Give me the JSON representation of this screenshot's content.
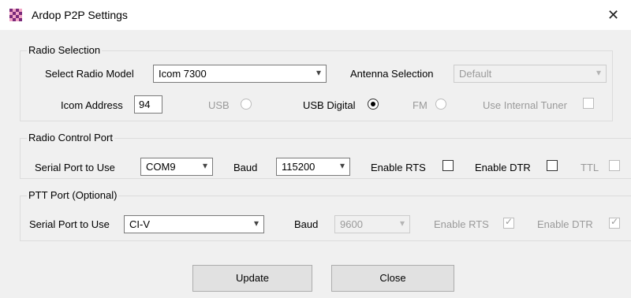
{
  "window": {
    "title": "Ardop P2P Settings",
    "close_glyph": "✕"
  },
  "radio_selection": {
    "legend": "Radio Selection",
    "model_label": "Select Radio Model",
    "model_value": "Icom 7300",
    "antenna_label": "Antenna Selection",
    "antenna_value": "Default",
    "address_label": "Icom Address",
    "address_value": "94",
    "usb_label": "USB",
    "usb_digital_label": "USB Digital",
    "fm_label": "FM",
    "internal_tuner_label": "Use Internal Tuner",
    "selected_mode": "USB Digital"
  },
  "control_port": {
    "legend": "Radio Control Port",
    "serial_label": "Serial Port to Use",
    "serial_value": "COM9",
    "baud_label": "Baud",
    "baud_value": "115200",
    "rts_label": "Enable RTS",
    "dtr_label": "Enable DTR",
    "ttl_label": "TTL"
  },
  "ptt_port": {
    "legend": "PTT Port (Optional)",
    "serial_label": "Serial Port to Use",
    "serial_value": "CI-V",
    "baud_label": "Baud",
    "baud_value": "9600",
    "rts_label": "Enable RTS",
    "dtr_label": "Enable DTR"
  },
  "buttons": {
    "update": "Update",
    "close": "Close"
  },
  "icons": {
    "dropdown": "▾",
    "check": "✓"
  }
}
